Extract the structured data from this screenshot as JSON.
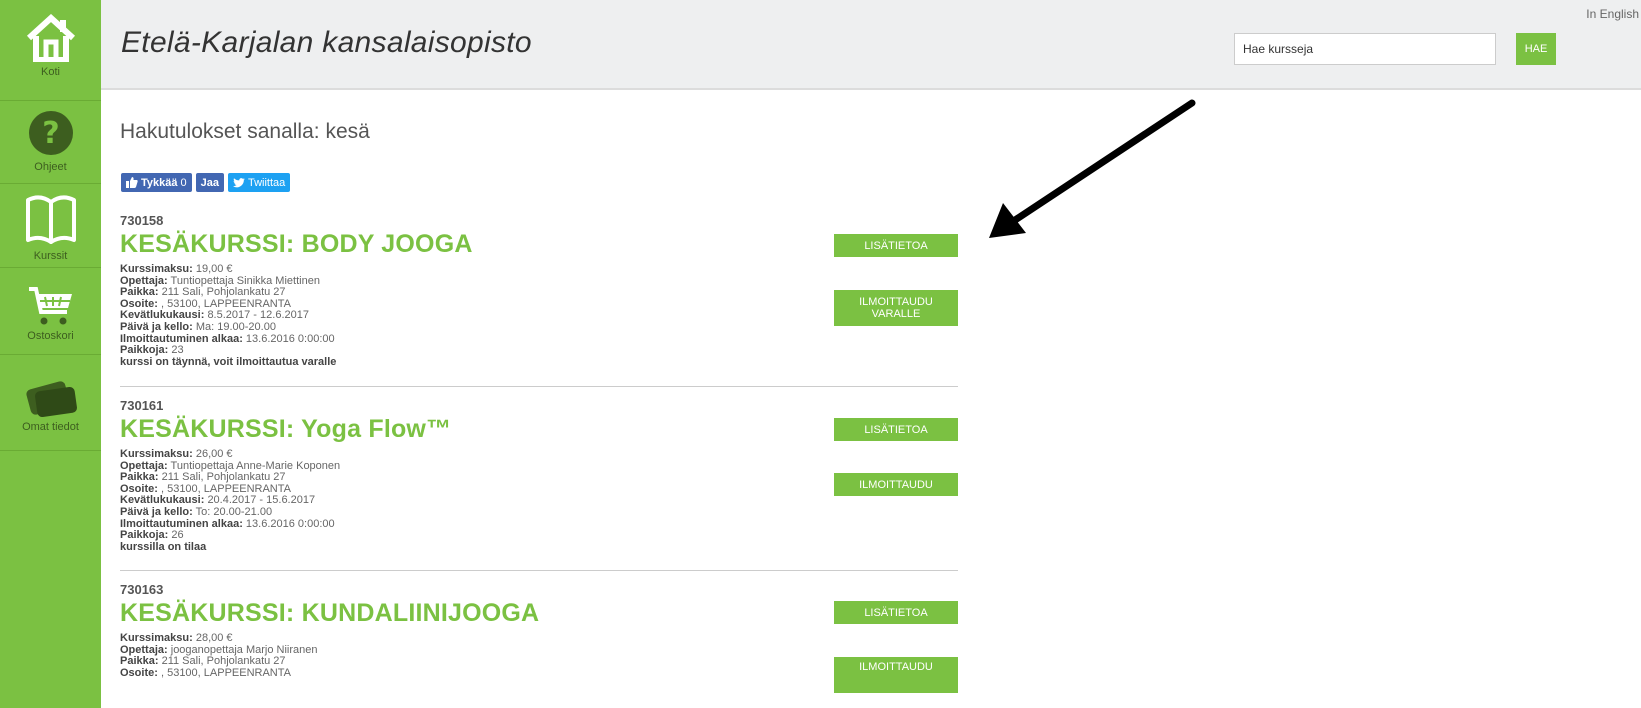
{
  "sidebar": {
    "items": [
      {
        "label": "Koti",
        "icon": "home-icon"
      },
      {
        "label": "Ohjeet",
        "icon": "help-icon"
      },
      {
        "label": "Kurssit",
        "icon": "book-icon"
      },
      {
        "label": "Ostoskori",
        "icon": "cart-icon"
      },
      {
        "label": "Omat tiedot",
        "icon": "profile-icon"
      }
    ]
  },
  "header": {
    "title": "Etelä-Karjalan kansalaisopisto",
    "lang_link": "In English",
    "search_placeholder": "Hae kursseja",
    "search_button": "HAE"
  },
  "main": {
    "heading": "Hakutulokset sanalla: kesä",
    "social": {
      "like": "Tykkää",
      "like_count": "0",
      "share": "Jaa",
      "tweet": "Twiittaa"
    },
    "courses": [
      {
        "code": "730158",
        "title": "KESÄKURSSI: BODY JOOGA",
        "fee_label": "Kurssimaksu:",
        "fee": "19,00 €",
        "teacher_label": "Opettaja:",
        "teacher": "Tuntiopettaja Sinikka Miettinen",
        "place_label": "Paikka:",
        "place": "211 Sali, Pohjolankatu 27",
        "address_label": "Osoite:",
        "address": ", 53100, LAPPEENRANTA",
        "term_label": "Kevätlukukausi:",
        "term": "8.5.2017 - 12.6.2017",
        "time_label": "Päivä ja kello:",
        "time": "Ma: 19.00-20.00",
        "enroll_label": "Ilmoittautuminen alkaa:",
        "enroll": "13.6.2016 0:00:00",
        "seats_label": "Paikkoja:",
        "seats": "23",
        "status": "kurssi on täynnä, voit ilmoittautua varalle",
        "info_button": "LISÄTIETOA",
        "action_button": "ILMOITTAUDU VARALLE"
      },
      {
        "code": "730161",
        "title": "KESÄKURSSI: Yoga Flow™",
        "fee_label": "Kurssimaksu:",
        "fee": "26,00 €",
        "teacher_label": "Opettaja:",
        "teacher": "Tuntiopettaja Anne-Marie Koponen",
        "place_label": "Paikka:",
        "place": "211 Sali, Pohjolankatu 27",
        "address_label": "Osoite:",
        "address": ", 53100, LAPPEENRANTA",
        "term_label": "Kevätlukukausi:",
        "term": "20.4.2017 - 15.6.2017",
        "time_label": "Päivä ja kello:",
        "time": "To: 20.00-21.00",
        "enroll_label": "Ilmoittautuminen alkaa:",
        "enroll": "13.6.2016 0:00:00",
        "seats_label": "Paikkoja:",
        "seats": "26",
        "status": "kurssilla on tilaa",
        "info_button": "LISÄTIETOA",
        "action_button": "ILMOITTAUDU"
      },
      {
        "code": "730163",
        "title": "KESÄKURSSI: KUNDALIINIJOOGA",
        "fee_label": "Kurssimaksu:",
        "fee": "28,00 €",
        "teacher_label": "Opettaja:",
        "teacher": "jooganopettaja Marjo Niiranen",
        "place_label": "Paikka:",
        "place": "211 Sali, Pohjolankatu 27",
        "address_label": "Osoite:",
        "address": ", 53100, LAPPEENRANTA",
        "info_button": "LISÄTIETOA",
        "action_button": "ILMOITTAUDU"
      }
    ]
  },
  "colors": {
    "brand_green": "#7bc142",
    "header_bg": "#eeeff0",
    "facebook_blue": "#4267b2",
    "twitter_blue": "#1da1f2"
  }
}
